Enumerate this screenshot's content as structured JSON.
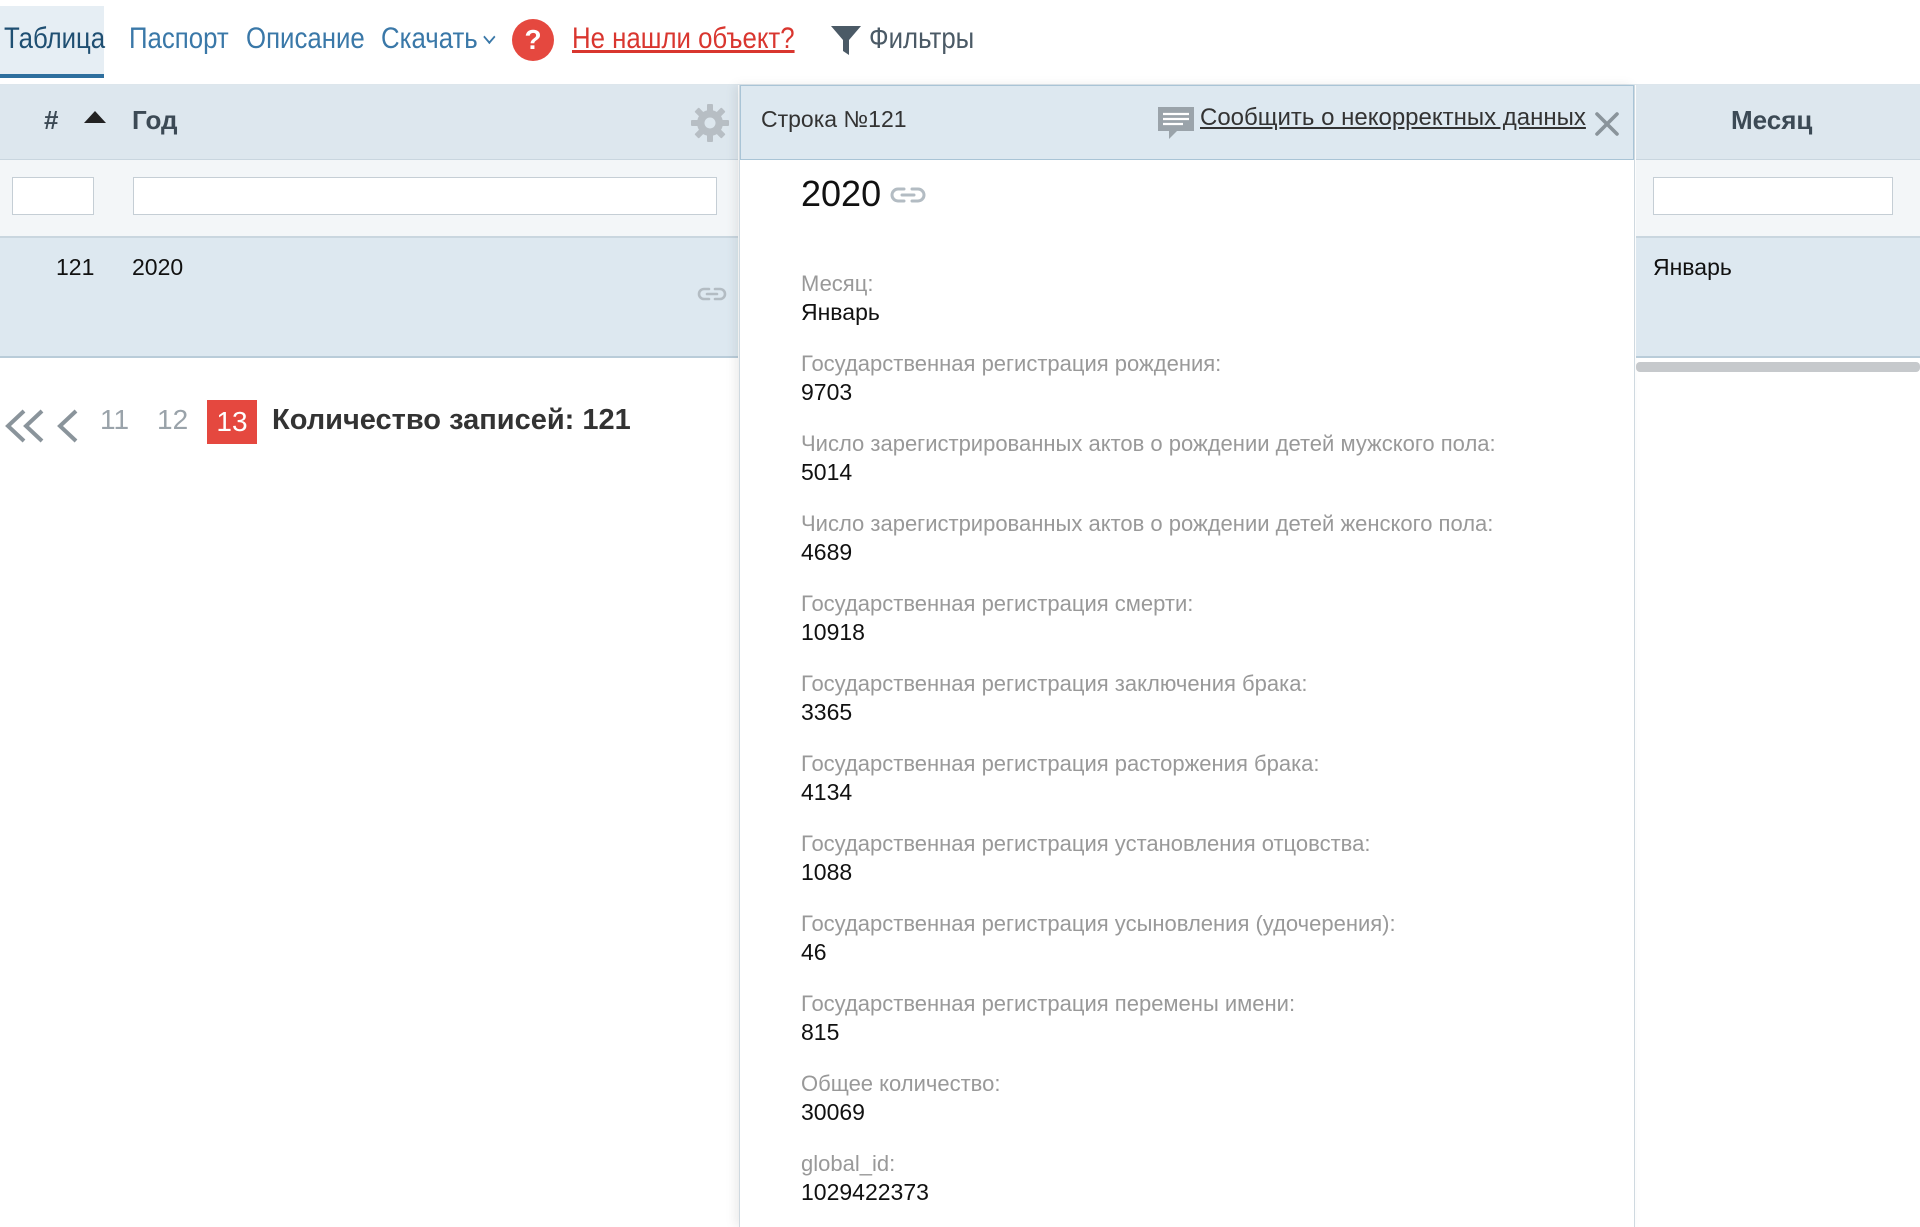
{
  "tabs": [
    {
      "label": "Таблица",
      "active": true
    },
    {
      "label": "Паспорт"
    },
    {
      "label": "Описание"
    },
    {
      "label": "Скачать"
    }
  ],
  "help": {
    "icon": "question-icon",
    "badge": "?",
    "link": "Не нашли объект?"
  },
  "filters": {
    "icon": "funnel-icon",
    "label": "Фильтры"
  },
  "table": {
    "columns": {
      "num": "#",
      "year": "Год",
      "month": "Месяц"
    },
    "row": {
      "num": "121",
      "year": "2020",
      "month": "Январь"
    }
  },
  "pagination": {
    "pages": [
      "11",
      "12"
    ],
    "current": "13",
    "records": "Количество записей: 121"
  },
  "detail": {
    "row_label": "Строка №121",
    "report": "Сообщить о некорректных данных",
    "title": "2020",
    "fields": [
      {
        "label": "Месяц:",
        "value": "Январь"
      },
      {
        "label": "Государственная регистрация рождения:",
        "value": "9703"
      },
      {
        "label": "Число зарегистрированных актов о рождении детей мужского пола:",
        "value": "5014"
      },
      {
        "label": "Число зарегистрированных актов о рождении детей женского пола:",
        "value": "4689"
      },
      {
        "label": "Государственная регистрация смерти:",
        "value": "10918"
      },
      {
        "label": "Государственная регистрация заключения брака:",
        "value": "3365"
      },
      {
        "label": "Государственная регистрация расторжения брака:",
        "value": "4134"
      },
      {
        "label": "Государственная регистрация установления отцовства:",
        "value": "1088"
      },
      {
        "label": "Государственная регистрация усыновления (удочерения):",
        "value": "46"
      },
      {
        "label": "Государственная регистрация перемены имени:",
        "value": "815"
      },
      {
        "label": "Общее количество:",
        "value": "30069"
      },
      {
        "label": "global_id:",
        "value": "1029422373"
      }
    ]
  },
  "colors": {
    "accent": "#3a78a8",
    "alert": "#e5483f",
    "header_bg": "#dde7ee",
    "selected_row": "#dde8f0"
  }
}
